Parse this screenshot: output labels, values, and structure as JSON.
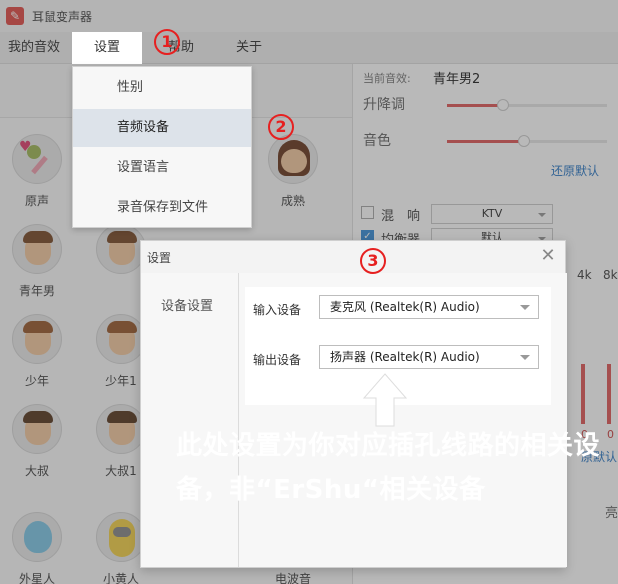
{
  "window": {
    "title": "耳鼠变声器"
  },
  "menu": [
    {
      "label": "我的音效"
    },
    {
      "label": "设置"
    },
    {
      "label": "帮助"
    },
    {
      "label": "关于"
    }
  ],
  "voices": [
    {
      "label": "原声",
      "icon": "microphone-heart-icon"
    },
    {
      "label": "成熟",
      "icon": "girl-avatar-icon"
    },
    {
      "label": "青年男",
      "icon": "young-man-avatar-icon"
    },
    {
      "label": "",
      "icon": "young-man-avatar-icon"
    },
    {
      "label": "少年",
      "icon": "boy-avatar-icon"
    },
    {
      "label": "少年1",
      "icon": "boy-avatar-icon"
    },
    {
      "label": "大叔",
      "icon": "uncle-avatar-icon"
    },
    {
      "label": "大叔1",
      "icon": "uncle-avatar-icon"
    },
    {
      "label": "外星人",
      "icon": "alien-avatar-icon"
    },
    {
      "label": "小黄人",
      "icon": "minion-avatar-icon"
    },
    {
      "label": "",
      "icon": "avatar-icon"
    },
    {
      "label": "电波音",
      "icon": "avatar-icon"
    }
  ],
  "right_panel": {
    "current_label": "当前音效:",
    "current_value": "青年男2",
    "pitch_label": "升降调",
    "pitch_level": 0.35,
    "timbre_label": "音色",
    "timbre_level": 0.48,
    "reset_link": "还原默认",
    "reverb_label": "混　响",
    "reverb_value": "KTV",
    "reverb_checked": false,
    "equalizer_label": "均衡器",
    "equalizer_value": "默认",
    "equalizer_checked": true,
    "eq_4k": "4k",
    "eq_8k": "8k",
    "eq_zero": "0",
    "reset_link2": "原默认",
    "bright_label": "亮"
  },
  "settings_menu": {
    "items": [
      {
        "label": "性别"
      },
      {
        "label": "音频设备"
      },
      {
        "label": "设置语言"
      },
      {
        "label": "录音保存到文件"
      }
    ],
    "selected_index": 1
  },
  "dialog": {
    "title": "设置",
    "close_glyph": "✕",
    "side_label": "设备设置",
    "input_label": "输入设备",
    "input_value": "麦克风 (Realtek(R) Audio)",
    "output_label": "输出设备",
    "output_value": "扬声器 (Realtek(R) Audio)"
  },
  "annotations": {
    "badge1": "1",
    "badge2": "2",
    "badge3": "3",
    "callout": "此处设置为你对应插孔线路的相关设备，非“ErShu“相关设备",
    "accent_color": "#e62020"
  }
}
